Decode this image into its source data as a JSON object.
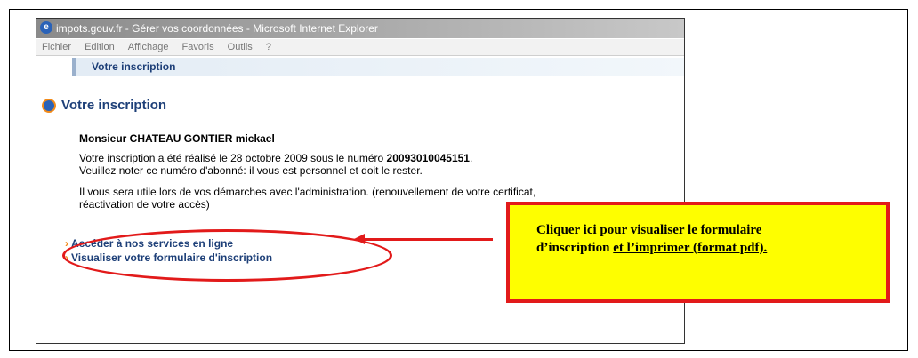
{
  "window": {
    "title": "impots.gouv.fr - Gérer vos coordonnées - Microsoft Internet Explorer"
  },
  "menu": [
    "Fichier",
    "Edition",
    "Affichage",
    "Favoris",
    "Outils",
    "?"
  ],
  "header": {
    "label": "Votre inscription"
  },
  "section": {
    "title": "Votre inscription"
  },
  "person": {
    "name": "Monsieur CHATEAU GONTIER mickael"
  },
  "info": {
    "text1_prefix": "Votre inscription a été réalisé le 28 octobre 2009 sous le numéro ",
    "number": "20093010045151",
    "text1_suffix": ".",
    "text2": "Veuillez noter ce numéro d'abonné: il vous est personnel et doit le rester.",
    "text3": "Il vous sera utile lors de vos démarches avec l'administration. (renouvellement de votre certificat,\nréactivation de votre accès)"
  },
  "links": {
    "services": "Accéder à nos services en ligne",
    "form": "Visualiser votre formulaire d'inscription"
  },
  "callout": {
    "line1": "Cliquer ici pour visualiser le formulaire",
    "line2_plain": "d’inscription ",
    "line2_underlined": "et l’imprimer (format pdf)."
  },
  "colors": {
    "annotation_red": "#e21a1a",
    "callout_yellow": "#fefe00",
    "link_blue": "#1d3f78",
    "arrow_orange": "#f28b1a"
  }
}
